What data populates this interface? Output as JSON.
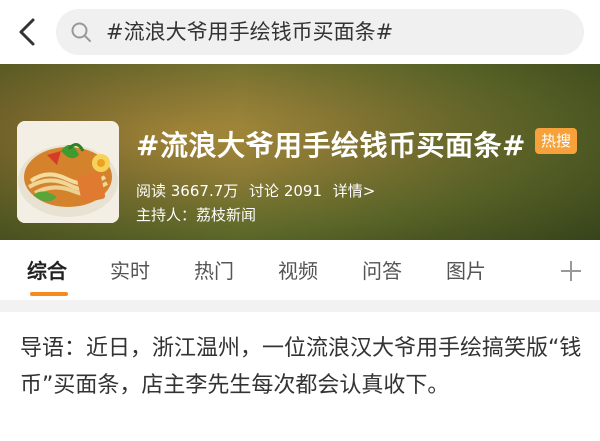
{
  "search": {
    "query": "#流浪大爷用手绘钱币买面条#"
  },
  "icons": {
    "back": "chevron-left-icon",
    "search": "magnifier-icon",
    "add": "plus-icon"
  },
  "banner": {
    "title": "#流浪大爷用手绘钱币买面条#",
    "badge": "热搜",
    "reads": "阅读 3667.7万",
    "discussions": "讨论 2091",
    "details": "详情>",
    "host": "主持人：荔枝新闻"
  },
  "tabs": {
    "items": [
      {
        "label": "综合"
      },
      {
        "label": "实时"
      },
      {
        "label": "热门"
      },
      {
        "label": "视频"
      },
      {
        "label": "问答"
      },
      {
        "label": "图片"
      }
    ],
    "active_index": 0
  },
  "intro": {
    "text": "导语：近日，浙江温州，一位流浪汉大爷用手绘搞笑版“钱币”买面条，店主李先生每次都会认真收下。"
  },
  "colors": {
    "accent": "#f58a1f",
    "badge": "#f6a13a"
  }
}
